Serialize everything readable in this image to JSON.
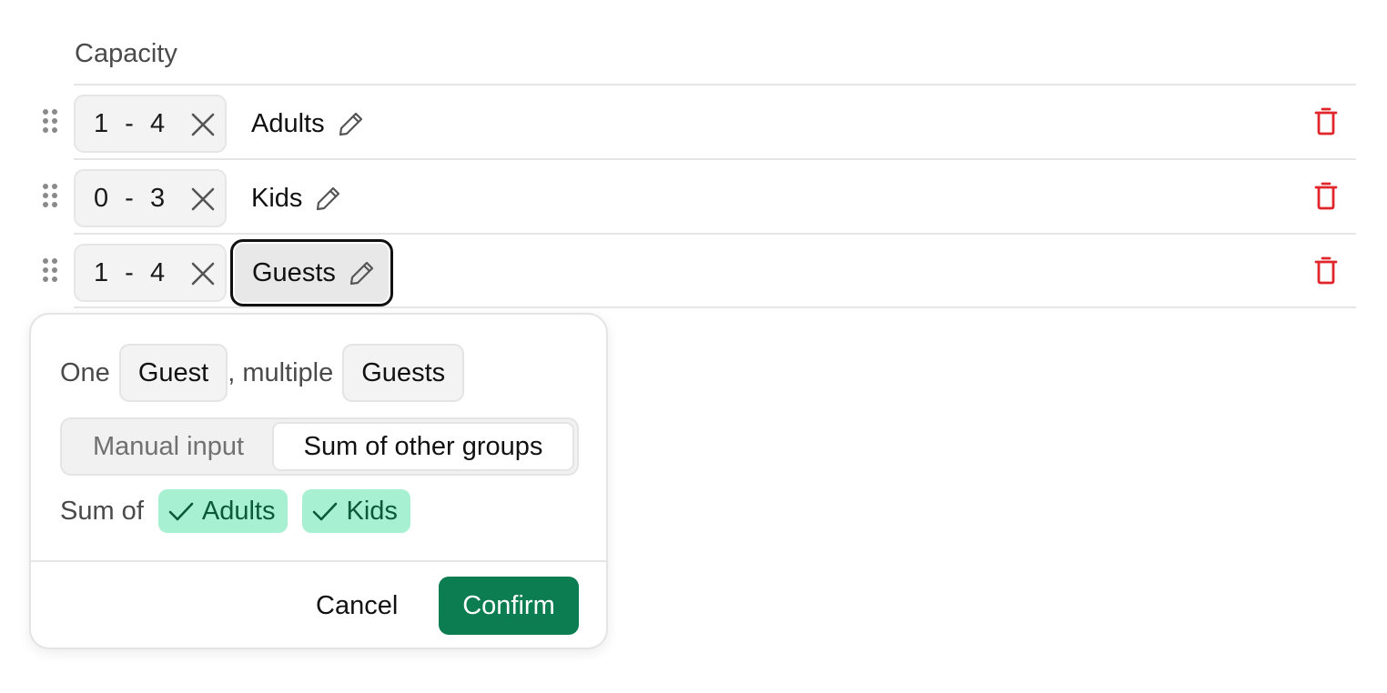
{
  "section": {
    "title": "Capacity"
  },
  "rows": [
    {
      "min": "1",
      "sep": "-",
      "max": "4",
      "label": "Adults"
    },
    {
      "min": "0",
      "sep": "-",
      "max": "3",
      "label": "Kids"
    },
    {
      "min": "1",
      "sep": "-",
      "max": "4",
      "label": "Guests"
    }
  ],
  "popover": {
    "one_text": "One",
    "singular": "Guest",
    "multiple_text": ", multiple",
    "plural": "Guests",
    "mode_options": [
      "Manual input",
      "Sum of other groups"
    ],
    "selected_mode": "Sum of other groups",
    "sum_of_text": "Sum of",
    "sum_tags": [
      "Adults",
      "Kids"
    ],
    "cancel_label": "Cancel",
    "confirm_label": "Confirm"
  },
  "colors": {
    "delete_red": "#e0262b",
    "confirm_green": "#0c7c51",
    "tag_bg": "#a8f0d2",
    "tag_text": "#0a5a39"
  },
  "icons": [
    "drag-handle-icon",
    "close-icon",
    "pencil-icon",
    "trash-icon",
    "check-icon"
  ]
}
